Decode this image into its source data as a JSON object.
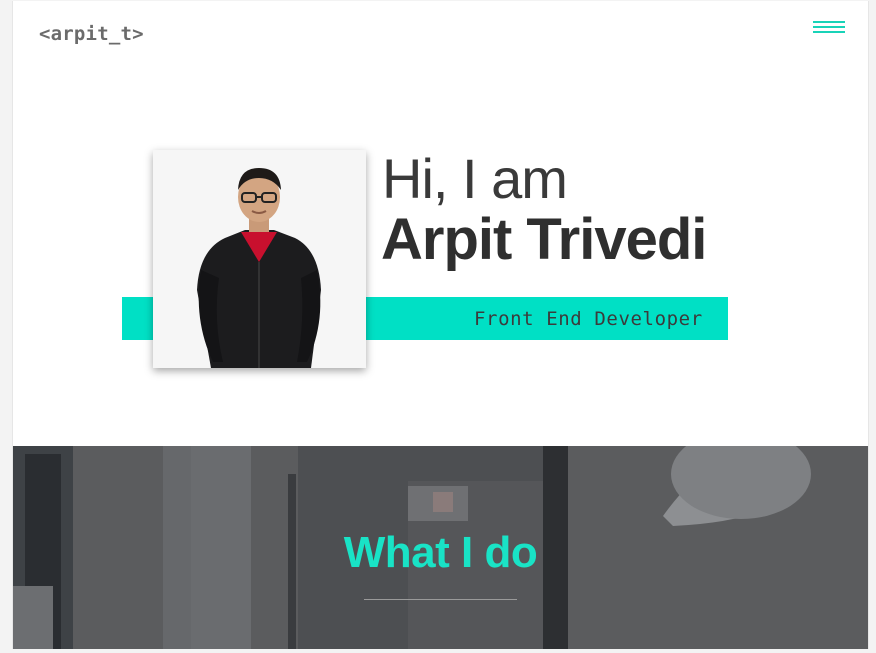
{
  "header": {
    "logo_text": "<arpit_t>",
    "menu_icon": "hamburger-icon"
  },
  "hero": {
    "greeting": "Hi, I am",
    "name": "Arpit Trivedi",
    "role": "Front End Developer",
    "accent_color": "#00e0c5"
  },
  "section": {
    "title": "What I do",
    "title_color": "#19e3c6"
  }
}
